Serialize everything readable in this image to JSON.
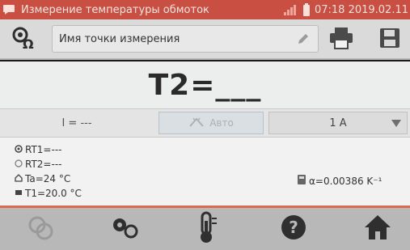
{
  "status_bar": {
    "title": "Измерение температуры обмоток",
    "datetime": "07:18 2019.02.11",
    "icon": "chat-icon"
  },
  "toolbar": {
    "name_field": "Имя точки измерения",
    "icons": [
      "ohm-probe-icon",
      "pencil-icon",
      "printer-icon",
      "save-icon"
    ]
  },
  "main": {
    "value": "T2=___"
  },
  "controls": {
    "current": "I = ---",
    "auto_label": "Авто",
    "range_value": "1 A"
  },
  "info": {
    "rt1": "RT1=---",
    "rt2": "RT2=---",
    "ta": "Ta=24 °C",
    "t1": "T1=20.0 °C",
    "alpha": "α=0.00386 K⁻¹"
  },
  "bottom_bar": {
    "icons": [
      "probe-icon",
      "settings-icon",
      "thermometer-icon",
      "help-icon",
      "home-icon"
    ]
  },
  "colors": {
    "status_bar": "#c94f43",
    "accent_line": "#d96a4c",
    "toolbar": "#dadada",
    "bottom_bar": "#b8b8b8"
  }
}
